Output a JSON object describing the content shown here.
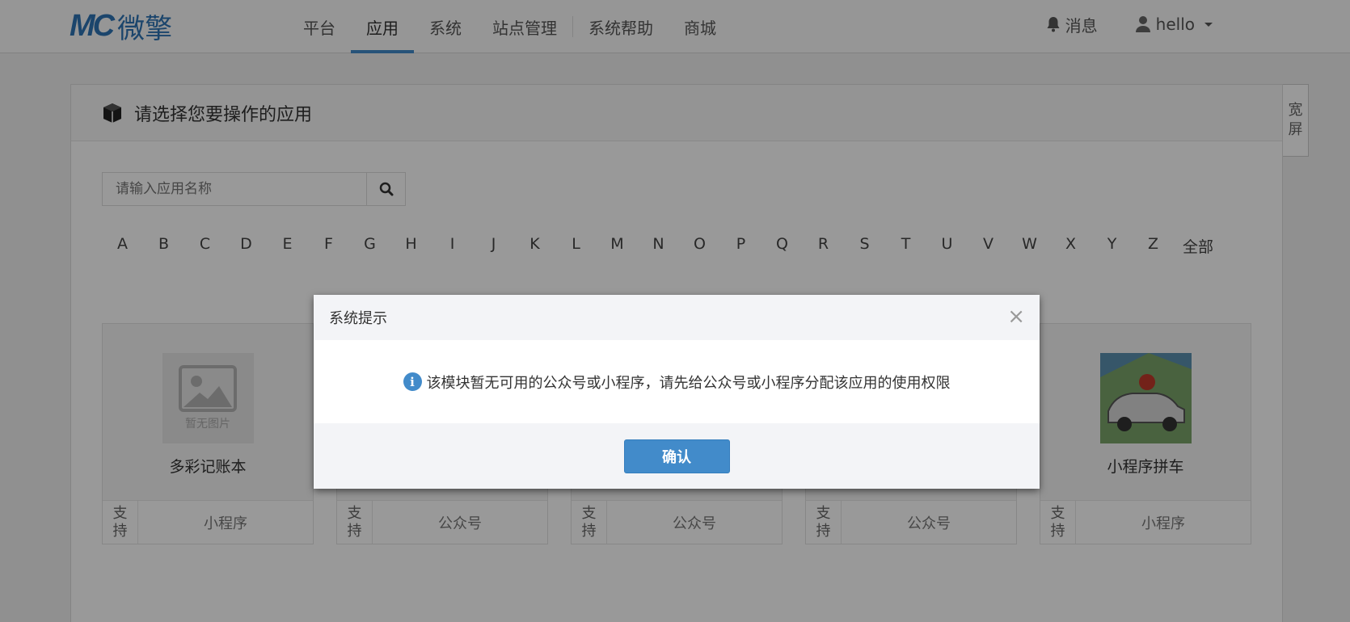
{
  "header": {
    "logo_mark": "MC",
    "logo_text": "微擎",
    "nav": [
      {
        "label": "平台"
      },
      {
        "label": "应用"
      },
      {
        "label": "系统"
      },
      {
        "label": "站点管理"
      },
      {
        "label": "系统帮助"
      },
      {
        "label": "商城"
      }
    ],
    "messages_label": "消息",
    "user_label": "hello"
  },
  "panel": {
    "title": "请选择您要操作的应用",
    "wide_label_1": "宽",
    "wide_label_2": "屏"
  },
  "search": {
    "placeholder": "请输入应用名称"
  },
  "letters": [
    "A",
    "B",
    "C",
    "D",
    "E",
    "F",
    "G",
    "H",
    "I",
    "J",
    "K",
    "L",
    "M",
    "N",
    "O",
    "P",
    "Q",
    "R",
    "S",
    "T",
    "U",
    "V",
    "W",
    "X",
    "Y",
    "Z"
  ],
  "letters_all": "全部",
  "cards": [
    {
      "name": "多彩记账本",
      "no_image": "暂无图片",
      "support_1": "支",
      "support_2": "持",
      "type": "小程序"
    },
    {
      "name": "",
      "support_1": "支",
      "support_2": "持",
      "type": "公众号"
    },
    {
      "name": "",
      "support_1": "支",
      "support_2": "持",
      "type": "公众号"
    },
    {
      "name": "",
      "support_1": "支",
      "support_2": "持",
      "type": "公众号"
    },
    {
      "name": "小程序拼车",
      "support_1": "支",
      "support_2": "持",
      "type": "小程序"
    }
  ],
  "modal": {
    "title": "系统提示",
    "close": "×",
    "message": "该模块暂无可用的公众号或小程序，请先给公众号或小程序分配该应用的使用权限",
    "ok_label": "确认"
  },
  "colors": {
    "accent": "#428bca",
    "logo": "#2e74b5"
  }
}
